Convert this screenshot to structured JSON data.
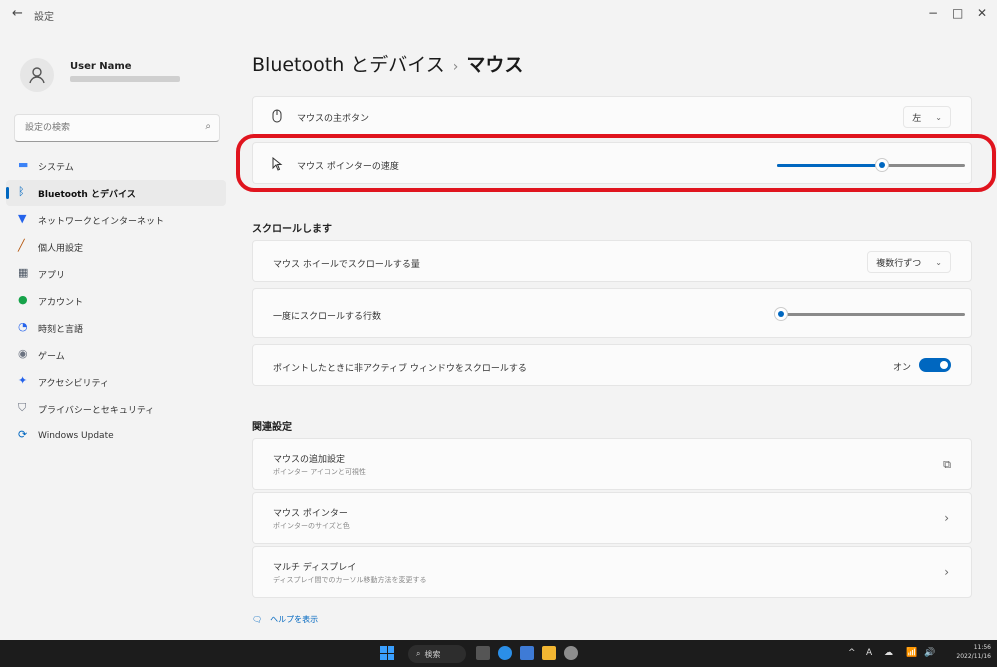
{
  "window": {
    "title": "設定",
    "minimize": "−",
    "maximize": "□",
    "close": "✕"
  },
  "user": {
    "name": "User Name"
  },
  "search": {
    "placeholder": "設定の検索"
  },
  "sidebar": {
    "items": [
      {
        "label": "システム",
        "icon": "system-icon",
        "color": "#3b82f6"
      },
      {
        "label": "Bluetooth とデバイス",
        "icon": "bluetooth-icon",
        "color": "#0067c0",
        "active": true
      },
      {
        "label": "ネットワークとインターネット",
        "icon": "network-icon",
        "color": "#2563eb"
      },
      {
        "label": "個人用設定",
        "icon": "brush-icon",
        "color": "#b45309"
      },
      {
        "label": "アプリ",
        "icon": "apps-icon",
        "color": "#4b5563"
      },
      {
        "label": "アカウント",
        "icon": "account-icon",
        "color": "#16a34a"
      },
      {
        "label": "時刻と言語",
        "icon": "time-language-icon",
        "color": "#2563eb"
      },
      {
        "label": "ゲーム",
        "icon": "gaming-icon",
        "color": "#6b7280"
      },
      {
        "label": "アクセシビリティ",
        "icon": "accessibility-icon",
        "color": "#2563eb"
      },
      {
        "label": "プライバシーとセキュリティ",
        "icon": "shield-icon",
        "color": "#6b7280"
      },
      {
        "label": "Windows Update",
        "icon": "windows-update-icon",
        "color": "#0067c0"
      }
    ]
  },
  "breadcrumb": {
    "parent": "Bluetooth とデバイス",
    "separator": "›",
    "current": "マウス"
  },
  "settings": {
    "primary_button": {
      "label": "マウスの主ボタン",
      "value": "左"
    },
    "pointer_speed": {
      "label": "マウス ポインターの速度",
      "value": 0.56
    },
    "scroll_section": "スクロールします",
    "wheel_scroll": {
      "label": "マウス ホイールでスクロールする量",
      "value": "複数行ずつ"
    },
    "lines_to_scroll": {
      "label": "一度にスクロールする行数",
      "value": 0.02
    },
    "inactive_scroll": {
      "label": "ポイントしたときに非アクティブ ウィンドウをスクロールする",
      "state": "オン",
      "on": true
    }
  },
  "related": {
    "title": "関連設定",
    "items": [
      {
        "label": "マウスの追加設定",
        "sub": "ポインター アイコンと可視性",
        "icon": "open-external-icon"
      },
      {
        "label": "マウス ポインター",
        "sub": "ポインターのサイズと色",
        "icon": "chevron-right-icon"
      },
      {
        "label": "マルチ ディスプレイ",
        "sub": "ディスプレイ間でのカーソル移動方法を変更する",
        "icon": "chevron-right-icon"
      }
    ]
  },
  "help": {
    "label": "ヘルプを表示"
  },
  "taskbar": {
    "search_label": "検索",
    "clock_time": "11:56",
    "clock_date": "2022/11/16",
    "tray": [
      "^",
      "A",
      "☁",
      "📶",
      "🔊"
    ],
    "accent": "#3aa0ff"
  },
  "colors": {
    "accent": "#0067c0",
    "highlight": "#e0141e"
  }
}
